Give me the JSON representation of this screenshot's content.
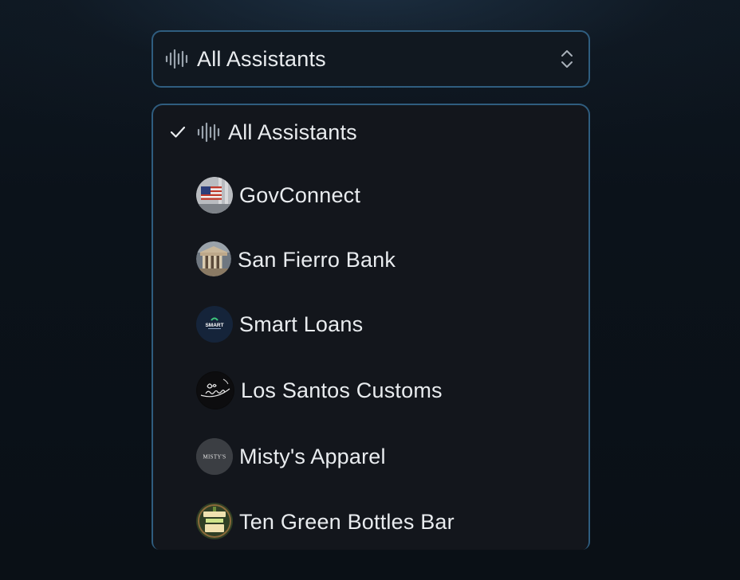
{
  "select": {
    "value": "All Assistants",
    "icon": "waveform-icon"
  },
  "options": [
    {
      "label": "All Assistants",
      "icon": "waveform-icon",
      "selected": true
    },
    {
      "label": "GovConnect",
      "avatar": "us-flag-building-avatar",
      "selected": false
    },
    {
      "label": "San Fierro Bank",
      "avatar": "bank-building-avatar",
      "selected": false
    },
    {
      "label": "Smart Loans",
      "avatar": "smart-loans-logo-avatar",
      "avatar_text": "SMART",
      "selected": false
    },
    {
      "label": "Los Santos Customs",
      "avatar": "los-santos-customs-logo-avatar",
      "selected": false
    },
    {
      "label": "Misty's Apparel",
      "avatar": "mistys-logo-avatar",
      "avatar_text": "MISTY'S",
      "selected": false
    },
    {
      "label": "Ten Green Bottles Bar",
      "avatar": "ten-green-bottles-logo-avatar",
      "selected": false
    }
  ],
  "colors": {
    "border_accent": "#2f5d7f",
    "panel_bg": "#13161c",
    "text": "#e9ecef",
    "icon_muted": "#9aa3ad"
  }
}
